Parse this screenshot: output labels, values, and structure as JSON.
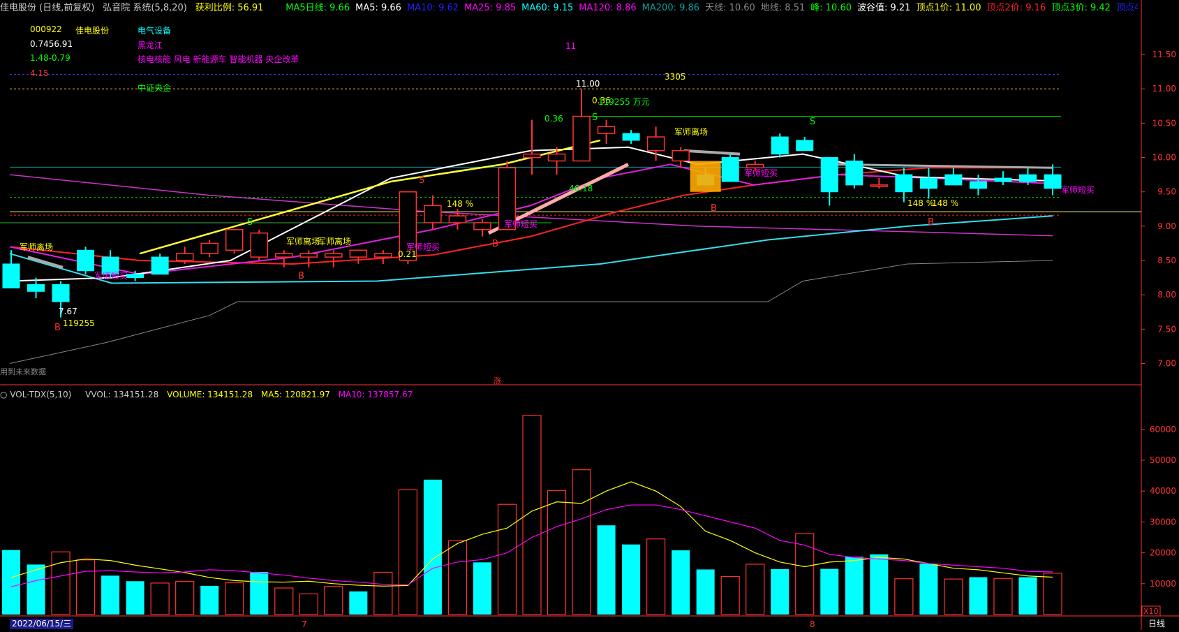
{
  "header": {
    "stock_name": "佳电股份 (日线,前复权)",
    "system_name": "弘音院 系统(5,8,20)",
    "profit_ratio": "获利比例: 56.91",
    "ma_labels": [
      {
        "text": "MA5日线: 9.66",
        "color": "#00ff00"
      },
      {
        "text": "MA5: 9.66",
        "color": "#ffffff"
      },
      {
        "text": "MA10: 9.62",
        "color": "#2222ff"
      },
      {
        "text": "MA25: 9.85",
        "color": "#ff00ff"
      },
      {
        "text": "MA60: 9.15",
        "color": "#00ffff"
      },
      {
        "text": "MA120: 8.86",
        "color": "#ff00ff"
      },
      {
        "text": "MA200: 9.86",
        "color": "#0e9e9e"
      },
      {
        "text": "天线: 10.60",
        "color": "#888888"
      },
      {
        "text": "地线: 8.51",
        "color": "#888888"
      },
      {
        "text": "峰: 10.60",
        "color": "#00ff00"
      },
      {
        "text": "波谷值: 9.21",
        "color": "#ffffff"
      },
      {
        "text": "顶点1价: 11.00",
        "color": "#ffff00"
      },
      {
        "text": "顶点2价: 9.16",
        "color": "#ff2222"
      },
      {
        "text": "顶点3价: 9.42",
        "color": "#00ff00"
      },
      {
        "text": "顶点4价: 11.21",
        "color": "#2222ff"
      }
    ]
  },
  "info_panel": {
    "code": "000922",
    "name": "佳电股份",
    "industry": "电气设备",
    "pe": "0.7456.91",
    "region": "黑龙江",
    "range": "1.48-0.79",
    "concepts": "核电核能 风电 新能源车 智能机器 央企改革",
    "value_415": "4.15",
    "index": "中证央企"
  },
  "price_annotations": {
    "peak_top": "11",
    "peak_price": "11.00",
    "vol_3305": "3305",
    "val_036a": "0.36",
    "val_036b": "0.36",
    "wan": "119255 万元",
    "low_price": "7.67",
    "low_vol": "119255",
    "val_021": "0.21",
    "val_4618": "46.18",
    "pct1": "148 %",
    "pct2": "148 %",
    "pct3": "148 %",
    "future_data": "用到未来数据",
    "zhang": "涨",
    "labels": [
      "军师离场",
      "军师短买",
      "军师离场",
      "军师短买",
      "军师离场",
      "军师短买",
      "军师离场",
      "军师短买",
      "军师短买"
    ]
  },
  "volume_header": {
    "name": "VOL-TDX(5,10)",
    "vvol": "VVOL: 134151.28",
    "volume": "VOLUME: 134151.28",
    "ma5": "MA5: 120821.97",
    "ma10": "MA10: 137857.67"
  },
  "footer": {
    "date": "2022/06/15/三",
    "month7": "7",
    "month8": "8",
    "period": "日线",
    "x10": "X10"
  },
  "colors": {
    "up": "#ff3232",
    "down": "#00ffff",
    "grid": "#8a0000",
    "axis": "#ff3232"
  },
  "chart_data": [
    {
      "type": "candlestick",
      "title": "",
      "ylim": [
        6.7,
        12.05
      ],
      "y_ticks": [
        7.0,
        7.5,
        8.0,
        8.5,
        9.0,
        9.5,
        10.0,
        10.5,
        11.0,
        11.5
      ],
      "candles": [
        {
          "o": 8.45,
          "h": 8.65,
          "l": 8.1,
          "c": 8.1
        },
        {
          "o": 8.15,
          "h": 8.25,
          "l": 7.95,
          "c": 8.05
        },
        {
          "o": 8.15,
          "h": 8.2,
          "l": 7.67,
          "c": 7.9
        },
        {
          "o": 8.65,
          "h": 8.7,
          "l": 8.3,
          "c": 8.35
        },
        {
          "o": 8.55,
          "h": 8.65,
          "l": 8.25,
          "c": 8.3
        },
        {
          "o": 8.3,
          "h": 8.35,
          "l": 8.2,
          "c": 8.25
        },
        {
          "o": 8.55,
          "h": 8.6,
          "l": 8.3,
          "c": 8.3
        },
        {
          "o": 8.5,
          "h": 8.7,
          "l": 8.45,
          "c": 8.6
        },
        {
          "o": 8.6,
          "h": 8.8,
          "l": 8.55,
          "c": 8.75
        },
        {
          "o": 8.65,
          "h": 8.95,
          "l": 8.6,
          "c": 8.95
        },
        {
          "o": 8.55,
          "h": 8.95,
          "l": 8.5,
          "c": 8.9
        },
        {
          "o": 8.55,
          "h": 8.65,
          "l": 8.4,
          "c": 8.6
        },
        {
          "o": 8.55,
          "h": 8.65,
          "l": 8.4,
          "c": 8.6
        },
        {
          "o": 8.55,
          "h": 8.65,
          "l": 8.4,
          "c": 8.6
        },
        {
          "o": 8.55,
          "h": 8.65,
          "l": 8.45,
          "c": 8.65
        },
        {
          "o": 8.55,
          "h": 8.65,
          "l": 8.45,
          "c": 8.6
        },
        {
          "o": 8.5,
          "h": 9.5,
          "l": 8.45,
          "c": 9.5
        },
        {
          "o": 9.05,
          "h": 9.45,
          "l": 8.95,
          "c": 9.3
        },
        {
          "o": 9.05,
          "h": 9.25,
          "l": 8.95,
          "c": 9.15
        },
        {
          "o": 8.95,
          "h": 9.1,
          "l": 8.85,
          "c": 9.05
        },
        {
          "o": 8.95,
          "h": 9.95,
          "l": 8.95,
          "c": 9.85
        },
        {
          "o": 10.0,
          "h": 10.55,
          "l": 9.75,
          "c": 10.05
        },
        {
          "o": 9.95,
          "h": 10.15,
          "l": 9.75,
          "c": 10.05
        },
        {
          "o": 9.95,
          "h": 11.0,
          "l": 9.95,
          "c": 10.6
        },
        {
          "o": 10.35,
          "h": 10.55,
          "l": 10.2,
          "c": 10.45
        },
        {
          "o": 10.35,
          "h": 10.4,
          "l": 10.2,
          "c": 10.25
        },
        {
          "o": 10.1,
          "h": 10.45,
          "l": 9.95,
          "c": 10.3
        },
        {
          "o": 9.95,
          "h": 10.15,
          "l": 9.85,
          "c": 10.1
        },
        {
          "o": 9.75,
          "h": 9.85,
          "l": 9.6,
          "c": 9.6
        },
        {
          "o": 10.0,
          "h": 10.05,
          "l": 9.65,
          "c": 9.65
        },
        {
          "o": 9.85,
          "h": 9.95,
          "l": 9.8,
          "c": 9.9
        },
        {
          "o": 10.3,
          "h": 10.35,
          "l": 10.0,
          "c": 10.05
        },
        {
          "o": 10.25,
          "h": 10.3,
          "l": 10.1,
          "c": 10.1
        },
        {
          "o": 10.0,
          "h": 10.0,
          "l": 9.3,
          "c": 9.5
        },
        {
          "o": 9.95,
          "h": 10.05,
          "l": 9.55,
          "c": 9.6
        },
        {
          "o": 9.6,
          "h": 9.7,
          "l": 9.55,
          "c": 9.6
        },
        {
          "o": 9.75,
          "h": 9.85,
          "l": 9.35,
          "c": 9.5
        },
        {
          "o": 9.7,
          "h": 9.85,
          "l": 9.4,
          "c": 9.55
        },
        {
          "o": 9.75,
          "h": 9.85,
          "l": 9.6,
          "c": 9.6
        },
        {
          "o": 9.65,
          "h": 9.75,
          "l": 9.45,
          "c": 9.55
        },
        {
          "o": 9.7,
          "h": 9.8,
          "l": 9.6,
          "c": 9.65
        },
        {
          "o": 9.75,
          "h": 9.85,
          "l": 9.6,
          "c": 9.65
        },
        {
          "o": 9.75,
          "h": 9.9,
          "l": 9.45,
          "c": 9.55
        }
      ]
    },
    {
      "type": "bar",
      "title": "",
      "ylim": [
        0,
        69000
      ],
      "y_ticks": [
        10000,
        20000,
        30000,
        40000,
        50000,
        60000
      ],
      "values": [
        20900,
        16200,
        20300,
        17700,
        12600,
        10800,
        10200,
        10700,
        9300,
        10300,
        13800,
        8600,
        6700,
        9100,
        7500,
        13700,
        40400,
        43700,
        23900,
        16900,
        35700,
        64500,
        40200,
        46900,
        28900,
        22700,
        24500,
        20800,
        14600,
        12300,
        16300,
        14700,
        26200,
        14800,
        18700,
        19500,
        11600,
        16500,
        11500,
        12100,
        11700,
        12100,
        13400
      ],
      "up_flags": [
        false,
        false,
        true,
        true,
        false,
        false,
        true,
        true,
        false,
        true,
        false,
        true,
        true,
        true,
        false,
        true,
        true,
        false,
        true,
        false,
        true,
        true,
        true,
        true,
        false,
        false,
        true,
        false,
        false,
        true,
        true,
        false,
        true,
        false,
        false,
        false,
        true,
        false,
        true,
        false,
        true,
        false,
        true
      ],
      "ma5": [
        12000,
        14500,
        16800,
        18000,
        17500,
        16000,
        14800,
        13600,
        12000,
        11000,
        10600,
        10500,
        10800,
        10000,
        9500,
        9200,
        9400,
        18000,
        23000,
        26000,
        28000,
        33500,
        36500,
        36000,
        40000,
        43000,
        40000,
        35000,
        27000,
        24000,
        20000,
        17000,
        15500,
        17000,
        17500,
        18500,
        18000,
        16500,
        15000,
        14500,
        13500,
        12500,
        12100
      ],
      "ma10": [
        9000,
        11000,
        12500,
        14000,
        14200,
        13800,
        13500,
        13800,
        14500,
        14200,
        13500,
        12800,
        11800,
        11000,
        10500,
        9800,
        9600,
        15000,
        17000,
        17800,
        20000,
        25000,
        28500,
        31000,
        34000,
        35500,
        35500,
        34000,
        32000,
        30000,
        28000,
        24000,
        22500,
        19500,
        18500,
        18000,
        17500,
        16500,
        16000,
        15500,
        15000,
        14000,
        13800
      ]
    }
  ]
}
